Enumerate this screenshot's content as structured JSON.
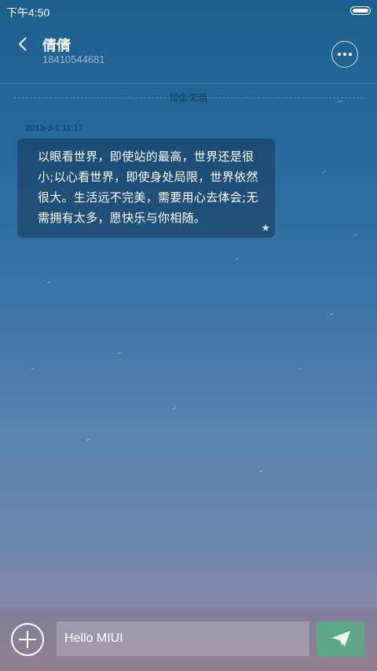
{
  "status": {
    "time": "下午4:50"
  },
  "header": {
    "title": "倩倩",
    "subtitle": "18410544681"
  },
  "divider": {
    "label": "短信/彩信"
  },
  "message": {
    "timestamp": "2013-3-1 11:17",
    "lines": [
      "以眼看世界，即使站的最高，世界还是很",
      "小;以心看世界，即使身处局限，世界依然",
      "很大。生活远不完美，需要用心去体会;无",
      "需拥有太多，愿快乐与你相随。"
    ]
  },
  "composer": {
    "text": "Hello MIUI"
  },
  "colors": {
    "send_button": "#5fa58a",
    "bubble": "#1a3a5c"
  },
  "icons": {
    "back": "chevron-left-icon",
    "more": "more-dots-icon",
    "add": "plus-icon",
    "send": "paper-plane-icon",
    "star": "star-icon"
  }
}
